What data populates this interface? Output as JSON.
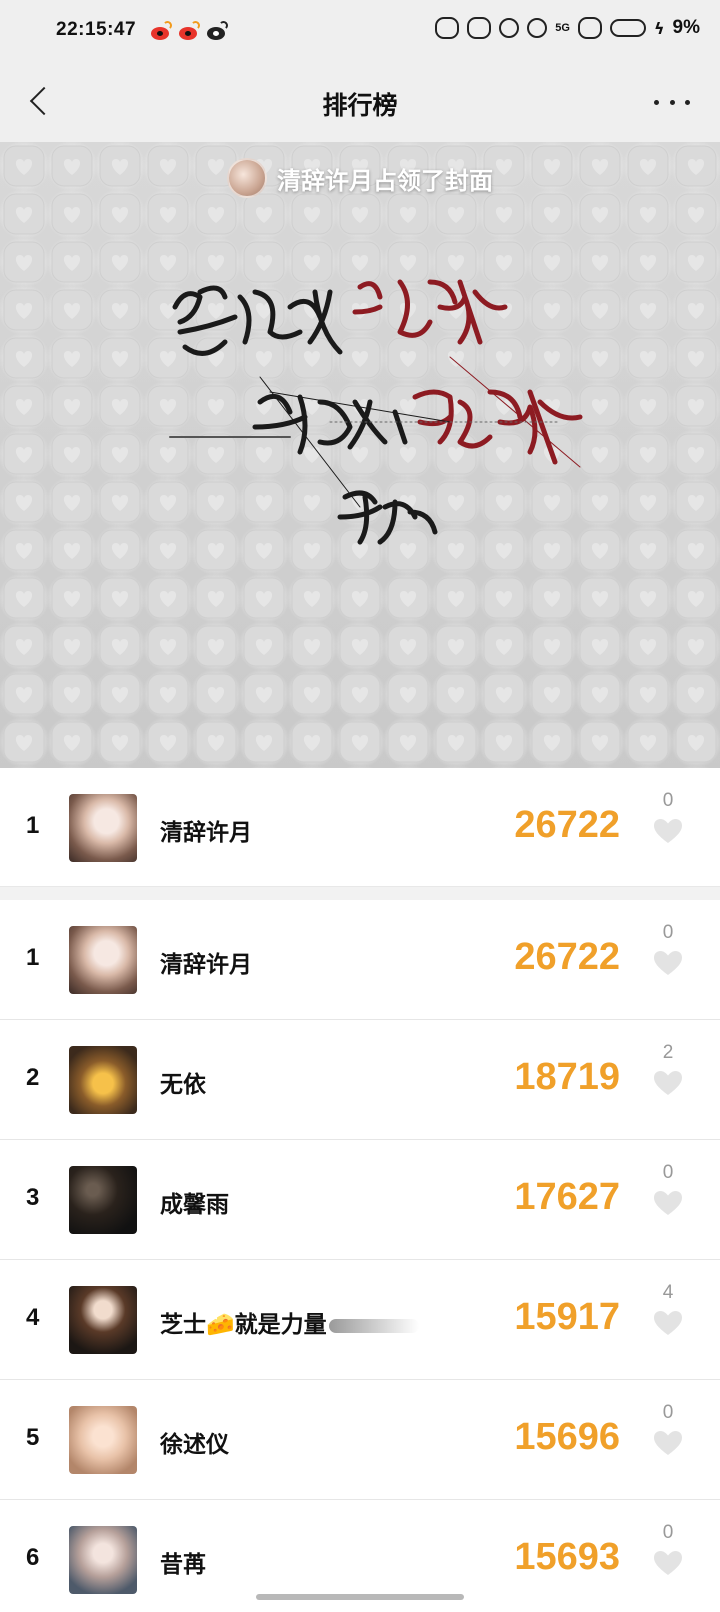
{
  "status_bar": {
    "time": "22:15:47",
    "network": "5G",
    "battery": "9%"
  },
  "nav": {
    "title": "排行榜"
  },
  "cover": {
    "banner": "清辞许月占领了封面"
  },
  "my_rank": {
    "rank": "1",
    "name": "清辞许月",
    "score": "26722",
    "likes": "0"
  },
  "rankings": [
    {
      "rank": "1",
      "name": "清辞许月",
      "score": "26722",
      "likes": "0"
    },
    {
      "rank": "2",
      "name": "无依",
      "score": "18719",
      "likes": "2"
    },
    {
      "rank": "3",
      "name": "成馨雨",
      "score": "17627",
      "likes": "0"
    },
    {
      "rank": "4",
      "name": "芝士🧀就是力量",
      "score": "15917",
      "likes": "4"
    },
    {
      "rank": "5",
      "name": "徐述仪",
      "score": "15696",
      "likes": "0"
    },
    {
      "rank": "6",
      "name": "昔苒",
      "score": "15693",
      "likes": "0"
    }
  ],
  "colors": {
    "score": "#f0a02a",
    "like_icon": "#e3e3e3",
    "bar_bg": "#efefef"
  }
}
